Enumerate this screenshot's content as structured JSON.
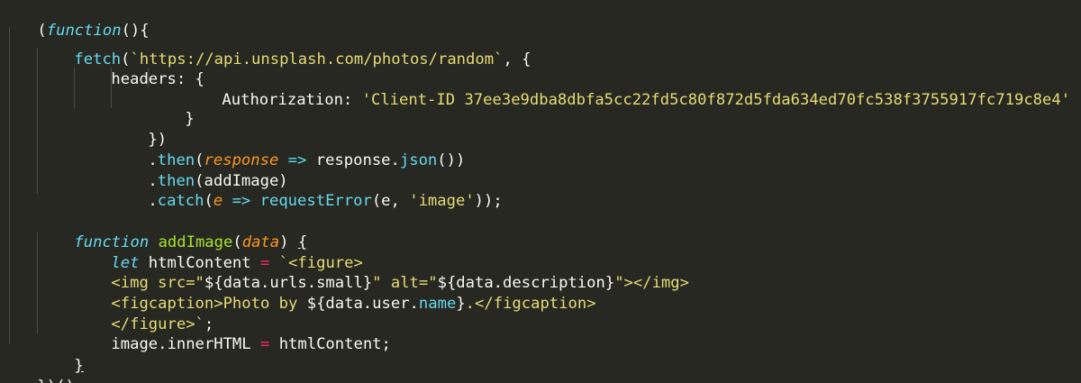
{
  "theme": {
    "background": "#272822",
    "foreground": "#f8f8f2",
    "keyword": "#66d9ef",
    "function_name": "#a6e22e",
    "parameter": "#fd971f",
    "string": "#e6db74",
    "operator": "#f92672",
    "indent_guide": "#4a4a44"
  },
  "code": {
    "l1": {
      "open": "(",
      "kw": "function",
      "rest": "(){"
    },
    "l2": {
      "fetch": "fetch",
      "paren": "(",
      "url": "`https://api.unsplash.com/photos/random`",
      "rest": ", {"
    },
    "l3": {
      "text": "headers: {"
    },
    "l4": {
      "key": "Authorization: ",
      "value": "'Client-ID 37ee3e9dba8dbfa5cc22fd5c80f872d5fda634ed70fc538f3755917fc719c8e4'"
    },
    "l5": {
      "text": "}"
    },
    "l6": {
      "text": "})"
    },
    "l7": {
      "dot": ".",
      "method": "then",
      "paren": "(",
      "param": "response",
      "arrow": " => ",
      "obj": "response.",
      "call": "json",
      "rest": "())"
    },
    "l8": {
      "dot": ".",
      "method": "then",
      "rest": "(addImage)"
    },
    "l9": {
      "dot": ".",
      "method": "catch",
      "paren": "(",
      "param": "e",
      "arrow": " => ",
      "call": "requestError",
      "mid": "(e, ",
      "str": "'image'",
      "rest": "));"
    },
    "l11": {
      "kw": "function",
      "space": " ",
      "name": "addImage",
      "paren": "(",
      "param": "data",
      "close": ") ",
      "brace": "{"
    },
    "l12": {
      "kw": "let",
      "name": " htmlContent ",
      "eq": "=",
      "sp": " ",
      "str": "`<figure>"
    },
    "l13": {
      "a": "<img src=\"",
      "b": "${data.urls.small}",
      "c": "\" alt=\"",
      "d": "${data.description}",
      "e": "\"></img>"
    },
    "l14": {
      "a": "<figcaption>Photo by ",
      "b": "${data.user.",
      "c": "name",
      "d": "}",
      "e": ".</figcaption>"
    },
    "l15": {
      "str": "</figure>`",
      "rest": ";"
    },
    "l16": {
      "a": "image.innerHTML ",
      "eq": "=",
      "b": " htmlContent;"
    },
    "l17": {
      "text": "}"
    },
    "l18": {
      "text": "})();"
    }
  }
}
